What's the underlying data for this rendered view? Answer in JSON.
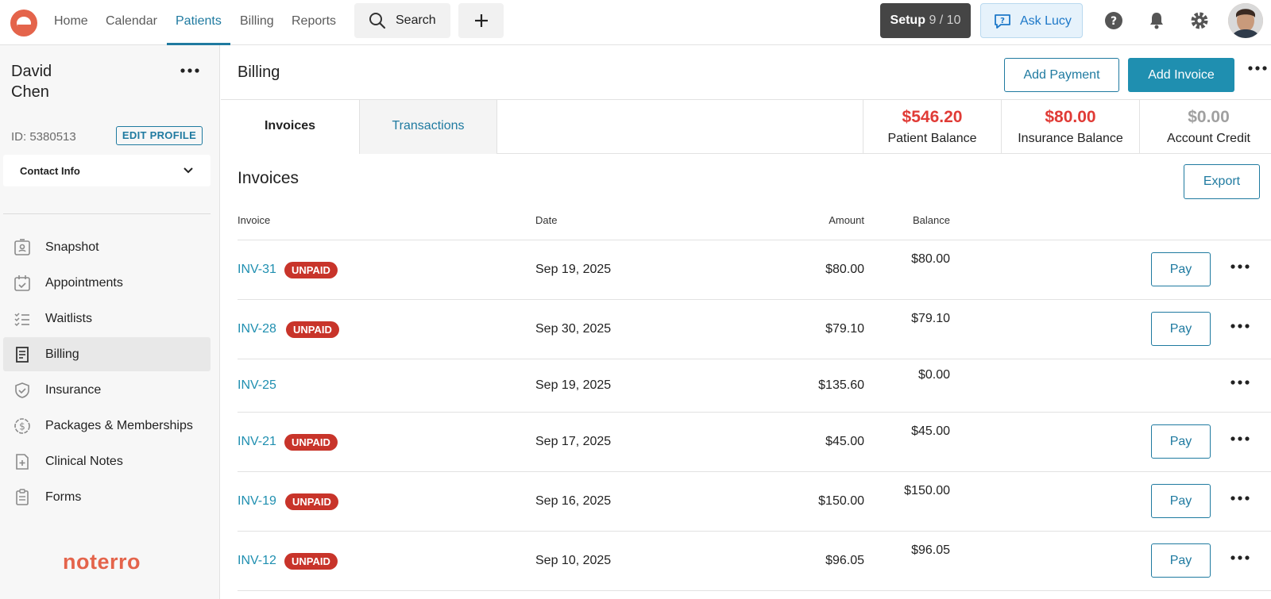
{
  "nav": {
    "items": [
      {
        "label": "Home"
      },
      {
        "label": "Calendar"
      },
      {
        "label": "Patients"
      },
      {
        "label": "Billing"
      },
      {
        "label": "Reports"
      }
    ],
    "active": "Patients",
    "search_label": "Search",
    "setup_label": "Setup",
    "setup_progress": "9 / 10",
    "ask_label": "Ask Lucy"
  },
  "sidebar": {
    "patient_first": "David",
    "patient_last": "Chen",
    "patient_id": "ID: 5380513",
    "edit_label": "EDIT PROFILE",
    "contact_label": "Contact Info",
    "items": [
      {
        "label": "Snapshot",
        "icon": "id-card-icon"
      },
      {
        "label": "Appointments",
        "icon": "calendar-check-icon"
      },
      {
        "label": "Waitlists",
        "icon": "checklist-icon"
      },
      {
        "label": "Billing",
        "icon": "receipt-icon"
      },
      {
        "label": "Insurance",
        "icon": "shield-check-icon"
      },
      {
        "label": "Packages & Memberships",
        "icon": "dollar-circle-icon"
      },
      {
        "label": "Clinical Notes",
        "icon": "note-plus-icon"
      },
      {
        "label": "Forms",
        "icon": "clipboard-icon"
      }
    ],
    "active": "Billing",
    "brand": "noterro"
  },
  "main": {
    "title": "Billing",
    "add_payment": "Add Payment",
    "add_invoice": "Add Invoice",
    "tabs": [
      {
        "label": "Invoices"
      },
      {
        "label": "Transactions"
      }
    ],
    "active_tab": "Invoices",
    "balances": [
      {
        "amount": "$546.20",
        "label": "Patient Balance",
        "color": "#e03b36"
      },
      {
        "amount": "$80.00",
        "label": "Insurance Balance",
        "color": "#e03b36"
      },
      {
        "amount": "$0.00",
        "label": "Account Credit",
        "color": "#a0a0a0"
      }
    ],
    "section_title": "Invoices",
    "export_label": "Export",
    "columns": {
      "invoice": "Invoice",
      "date": "Date",
      "amount": "Amount",
      "balance": "Balance"
    },
    "pay_label": "Pay",
    "invoices": [
      {
        "id": "INV-31",
        "status": "UNPAID",
        "date": "Sep 19, 2025",
        "amount": "$80.00",
        "balance": "$80.00"
      },
      {
        "id": "INV-28",
        "status": "UNPAID",
        "date": "Sep 30, 2025",
        "amount": "$79.10",
        "balance": "$79.10"
      },
      {
        "id": "INV-25",
        "status": "",
        "date": "Sep 19, 2025",
        "amount": "$135.60",
        "balance": "$0.00"
      },
      {
        "id": "INV-21",
        "status": "UNPAID",
        "date": "Sep 17, 2025",
        "amount": "$45.00",
        "balance": "$45.00"
      },
      {
        "id": "INV-19",
        "status": "UNPAID",
        "date": "Sep 16, 2025",
        "amount": "$150.00",
        "balance": "$150.00"
      },
      {
        "id": "INV-12",
        "status": "UNPAID",
        "date": "Sep 10, 2025",
        "amount": "$96.05",
        "balance": "$96.05"
      }
    ]
  },
  "colors": {
    "accent": "#1f7aa0",
    "brand": "#e4644b",
    "unpaid": "#c8342a"
  }
}
